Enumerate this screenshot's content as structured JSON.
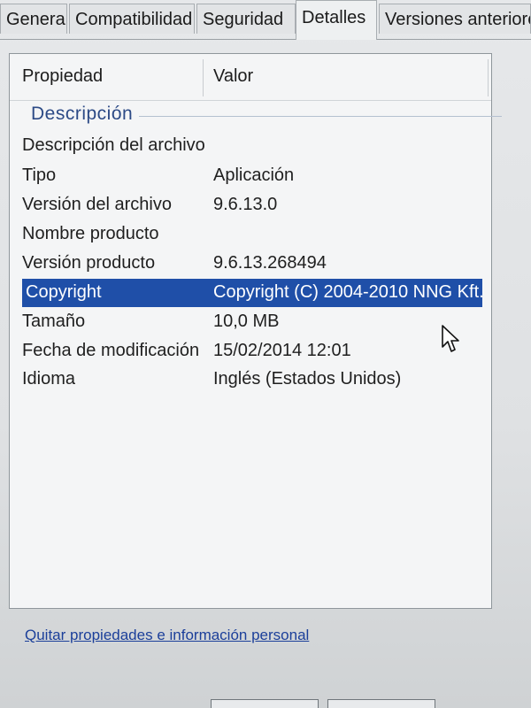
{
  "tabs": [
    {
      "label": "General",
      "active": false
    },
    {
      "label": "Compatibilidad",
      "active": false
    },
    {
      "label": "Seguridad",
      "active": false
    },
    {
      "label": "Detalles",
      "active": true
    },
    {
      "label": "Versiones anteriores",
      "active": false
    }
  ],
  "table": {
    "headers": {
      "property": "Propiedad",
      "value": "Valor"
    },
    "group": "Descripción",
    "rows": [
      {
        "property": "Descripción del archivo",
        "value": ""
      },
      {
        "property": "Tipo",
        "value": "Aplicación"
      },
      {
        "property": "Versión del archivo",
        "value": "9.6.13.0"
      },
      {
        "property": "Nombre producto",
        "value": ""
      },
      {
        "property": "Versión producto",
        "value": "9.6.13.268494"
      },
      {
        "property": "Copyright",
        "value": "Copyright (C) 2004-2010 NNG Kft.",
        "selected": true
      },
      {
        "property": "Tamaño",
        "value": "10,0 MB"
      },
      {
        "property": "Fecha de modificación",
        "value": "15/02/2014 12:01"
      },
      {
        "property": "Idioma",
        "value": "Inglés (Estados Unidos)"
      }
    ]
  },
  "link": {
    "label": "Quitar propiedades e información personal"
  },
  "colors": {
    "selection": "#1f4fa8",
    "group_header": "#2c4a86",
    "link": "#1b3f9a"
  },
  "icons": {
    "cursor": "mouse-pointer-icon"
  }
}
